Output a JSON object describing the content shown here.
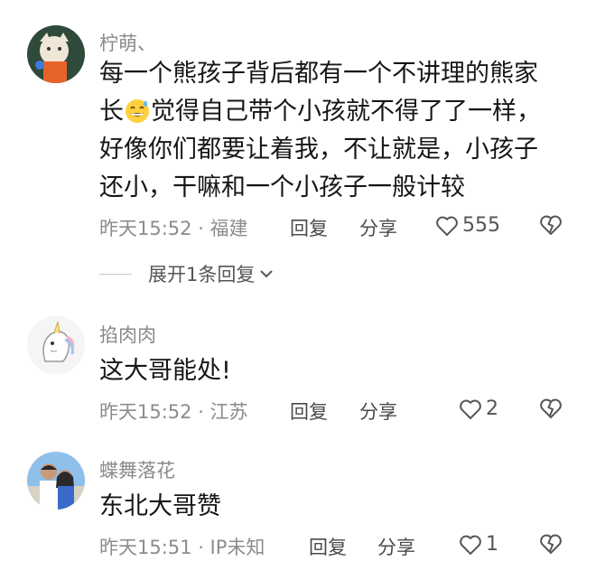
{
  "comments": [
    {
      "username": "柠萌、",
      "lines": [
        "每一个熊孩子背后都有一个不讲理的熊家",
        "觉得自己带个小孩就不得了了一样，",
        "好像你们都要让着我，不让就是，小孩子",
        "还小，干嘛和一个小孩子一般计较"
      ],
      "line2_prefix": "长",
      "emoji": "sweat-smile-emoji",
      "time": "昨天15:52 · 福建",
      "reply_label": "回复",
      "share_label": "分享",
      "like_count": "555",
      "expand_label": "展开1条回复"
    },
    {
      "username": "掐肉肉",
      "text": "这大哥能处!",
      "time": "昨天15:52 · 江苏",
      "reply_label": "回复",
      "share_label": "分享",
      "like_count": "2"
    },
    {
      "username": "蝶舞落花",
      "text": "东北大哥赞",
      "time": "昨天15:51 · IP未知",
      "reply_label": "回复",
      "share_label": "分享",
      "like_count": "1"
    }
  ]
}
